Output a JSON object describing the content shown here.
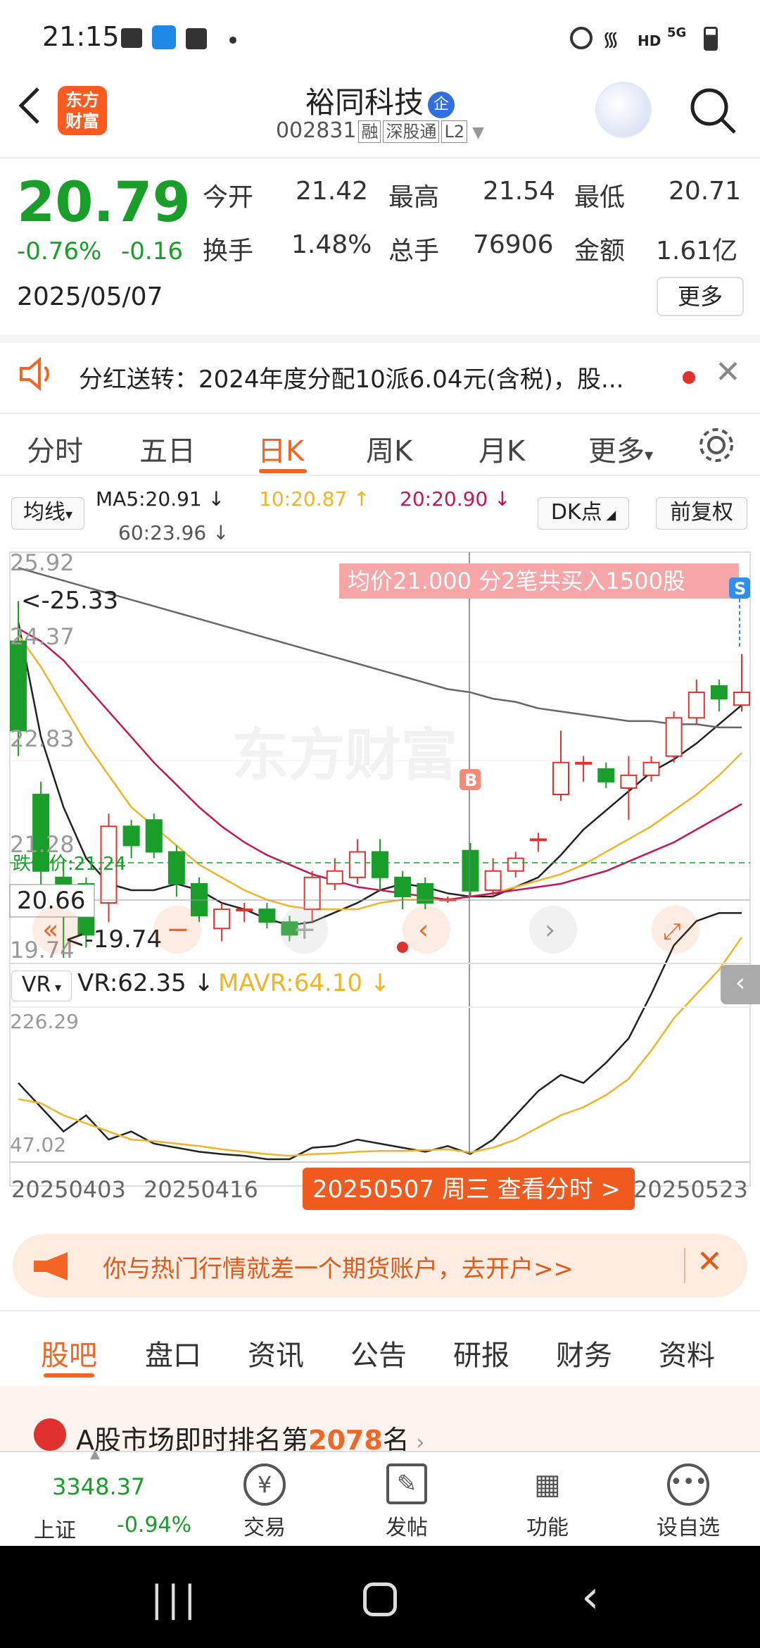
{
  "status_bar": {
    "time": "21:15",
    "net": "HD",
    "signal": "5G"
  },
  "header": {
    "logo_text": "东方财富",
    "stock_name": "裕同科技",
    "badge": "企",
    "code": "002831",
    "tags": [
      "融",
      "深股通",
      "L2"
    ]
  },
  "quote": {
    "price": "20.79",
    "change_pct": "-0.76%",
    "change": "-0.16",
    "date": "2025/05/07",
    "open_label": "今开",
    "open": "21.42",
    "high_label": "最高",
    "high": "21.54",
    "low_label": "最低",
    "low": "20.71",
    "turnover_label": "换手",
    "turnover": "1.48%",
    "volume_label": "总手",
    "volume": "76906",
    "amount_label": "金额",
    "amount": "1.61亿",
    "more_label": "更多"
  },
  "notice": {
    "text": "分红送转：2024年度分配10派6.04元(含税)，股..."
  },
  "chart_tabs": [
    "分时",
    "五日",
    "日K",
    "周K",
    "月K",
    "更多"
  ],
  "active_tab": "日K",
  "indicators": {
    "ma_selector": "均线",
    "ma5": "MA5:20.91",
    "ma10": "10:20.87",
    "ma20": "20:20.90",
    "ma60": "60:23.96",
    "dk_label": "DK点",
    "adjust_label": "前复权"
  },
  "kchart": {
    "y_labels": [
      "25.92",
      "24.37",
      "22.83",
      "21.28",
      "19.74"
    ],
    "high_marker": "<-25.33",
    "low_marker": "<-19.74",
    "cursor_price": "20.66",
    "limit_label": "跌停价:21.24",
    "trade_banner": "均价21.000  分2笔共买入1500股",
    "buy_tag": "B",
    "sell_tag": "S",
    "watermark": "东方财富"
  },
  "vr": {
    "selector": "VR",
    "vr_value": "VR:62.35",
    "mavr_value": "MAVR:64.10",
    "y_top": "226.29",
    "y_bottom": "47.02"
  },
  "x_axis": {
    "start": "20250403",
    "mid": "20250416",
    "end": "20250523",
    "cursor": "20250507 周三 查看分时 >"
  },
  "chart_data": {
    "type": "candlestick",
    "series": [
      {
        "name": "K",
        "values": [
          {
            "o": 24.7,
            "c": 23.3,
            "h": 25.33,
            "l": 22.9
          },
          {
            "o": 22.3,
            "c": 21.1,
            "h": 22.5,
            "l": 20.8
          },
          {
            "o": 21.0,
            "c": 20.7,
            "h": 21.3,
            "l": 19.74
          },
          {
            "o": 20.9,
            "c": 20.1,
            "h": 21.0,
            "l": 19.9
          },
          {
            "o": 20.6,
            "c": 21.8,
            "h": 22.0,
            "l": 20.3
          },
          {
            "o": 21.8,
            "c": 21.5,
            "h": 21.9,
            "l": 21.3
          },
          {
            "o": 21.9,
            "c": 21.4,
            "h": 22.0,
            "l": 21.3
          },
          {
            "o": 21.4,
            "c": 20.9,
            "h": 21.5,
            "l": 20.7
          },
          {
            "o": 20.9,
            "c": 20.4,
            "h": 21.0,
            "l": 20.3
          },
          {
            "o": 20.2,
            "c": 20.5,
            "h": 20.6,
            "l": 20.0
          },
          {
            "o": 20.5,
            "c": 20.5,
            "h": 20.6,
            "l": 20.3
          },
          {
            "o": 20.5,
            "c": 20.3,
            "h": 20.6,
            "l": 20.2
          },
          {
            "o": 20.3,
            "c": 20.1,
            "h": 20.4,
            "l": 20.0
          },
          {
            "o": 20.5,
            "c": 21.0,
            "h": 21.1,
            "l": 20.3
          },
          {
            "o": 20.9,
            "c": 21.1,
            "h": 21.3,
            "l": 20.8
          },
          {
            "o": 21.0,
            "c": 21.4,
            "h": 21.6,
            "l": 20.9
          },
          {
            "o": 21.4,
            "c": 21.0,
            "h": 21.6,
            "l": 20.8
          },
          {
            "o": 21.0,
            "c": 20.7,
            "h": 21.1,
            "l": 20.5
          },
          {
            "o": 20.9,
            "c": 20.6,
            "h": 21.0,
            "l": 20.5
          },
          {
            "o": 20.66,
            "c": 20.66,
            "h": 20.7,
            "l": 20.6
          },
          {
            "o": 21.42,
            "c": 20.79,
            "h": 21.54,
            "l": 20.71
          },
          {
            "o": 20.8,
            "c": 21.1,
            "h": 21.3,
            "l": 20.7
          },
          {
            "o": 21.1,
            "c": 21.3,
            "h": 21.4,
            "l": 21.0
          },
          {
            "o": 21.6,
            "c": 21.6,
            "h": 21.7,
            "l": 21.4
          },
          {
            "o": 22.3,
            "c": 22.8,
            "h": 23.3,
            "l": 22.2
          },
          {
            "o": 22.8,
            "c": 22.8,
            "h": 22.9,
            "l": 22.5
          },
          {
            "o": 22.7,
            "c": 22.5,
            "h": 22.8,
            "l": 22.4
          },
          {
            "o": 22.4,
            "c": 22.6,
            "h": 22.9,
            "l": 21.9
          },
          {
            "o": 22.6,
            "c": 22.8,
            "h": 22.9,
            "l": 22.5
          },
          {
            "o": 22.9,
            "c": 23.5,
            "h": 23.6,
            "l": 22.8
          },
          {
            "o": 23.5,
            "c": 23.9,
            "h": 24.1,
            "l": 23.4
          },
          {
            "o": 24.0,
            "c": 23.8,
            "h": 24.1,
            "l": 23.6
          },
          {
            "o": 23.7,
            "c": 23.9,
            "h": 24.5,
            "l": 23.6
          }
        ]
      },
      {
        "name": "MA5",
        "values": [
          25.0,
          23.2,
          22.1,
          21.3,
          20.9,
          20.8,
          20.8,
          20.9,
          20.8,
          20.6,
          20.5,
          20.35,
          20.25,
          20.3,
          20.45,
          20.6,
          20.8,
          20.9,
          20.85,
          20.75,
          20.7,
          20.7,
          20.85,
          21.0,
          21.35,
          21.75,
          22.05,
          22.35,
          22.65,
          22.85,
          23.1,
          23.4,
          23.7
        ]
      },
      {
        "name": "MA10",
        "values": [
          24.8,
          24.3,
          23.7,
          23.1,
          22.6,
          22.1,
          21.8,
          21.5,
          21.2,
          21.0,
          20.8,
          20.65,
          20.55,
          20.5,
          20.5,
          20.5,
          20.6,
          20.65,
          20.65,
          20.65,
          20.7,
          20.75,
          20.85,
          20.95,
          21.05,
          21.2,
          21.4,
          21.6,
          21.8,
          22.05,
          22.3,
          22.6,
          22.95
        ]
      },
      {
        "name": "MA20",
        "values": [
          24.9,
          24.7,
          24.4,
          24.0,
          23.6,
          23.2,
          22.8,
          22.45,
          22.1,
          21.8,
          21.55,
          21.35,
          21.2,
          21.05,
          20.95,
          20.85,
          20.8,
          20.75,
          20.7,
          20.65,
          20.7,
          20.75,
          20.8,
          20.85,
          20.9,
          21.0,
          21.1,
          21.25,
          21.4,
          21.55,
          21.75,
          21.95,
          22.15
        ]
      },
      {
        "name": "MA60",
        "values": [
          25.85,
          25.75,
          25.65,
          25.55,
          25.45,
          25.35,
          25.25,
          25.15,
          25.05,
          24.95,
          24.85,
          24.75,
          24.65,
          24.55,
          24.45,
          24.35,
          24.25,
          24.15,
          24.05,
          23.95,
          23.9,
          23.8,
          23.75,
          23.65,
          23.6,
          23.55,
          23.5,
          23.45,
          23.45,
          23.4,
          23.4,
          23.35,
          23.35
        ]
      },
      {
        "name": "VR",
        "values": [
          150,
          120,
          90,
          110,
          80,
          90,
          75,
          70,
          65,
          62,
          60,
          55,
          50,
          70,
          72,
          80,
          75,
          70,
          65,
          72,
          62.35,
          80,
          110,
          140,
          160,
          150,
          175,
          205,
          260,
          320,
          350,
          360,
          360
        ]
      },
      {
        "name": "MAVR",
        "values": [
          130,
          125,
          110,
          100,
          90,
          80,
          78,
          75,
          72,
          68,
          65,
          62,
          60,
          62,
          63,
          65,
          66,
          66,
          67,
          68,
          64.1,
          70,
          80,
          95,
          110,
          120,
          135,
          155,
          190,
          230,
          260,
          290,
          330
        ]
      }
    ],
    "ylim": [
      19.74,
      25.92
    ],
    "vr_ylim": [
      47.02,
      226.29
    ]
  },
  "promo": {
    "text": "你与热门行情就差一个期货账户，去开户>>"
  },
  "bottom_tabs": [
    "股吧",
    "盘口",
    "资讯",
    "公告",
    "研报",
    "财务",
    "资料"
  ],
  "rank": {
    "prefix": "A股市场即时排名第",
    "number": "2078",
    "suffix": "名"
  },
  "index": {
    "value": "3348.37",
    "name": "上证",
    "change": "-0.94%"
  },
  "nav": [
    {
      "label": "交易"
    },
    {
      "label": "发帖"
    },
    {
      "label": "功能"
    },
    {
      "label": "设自选"
    }
  ]
}
